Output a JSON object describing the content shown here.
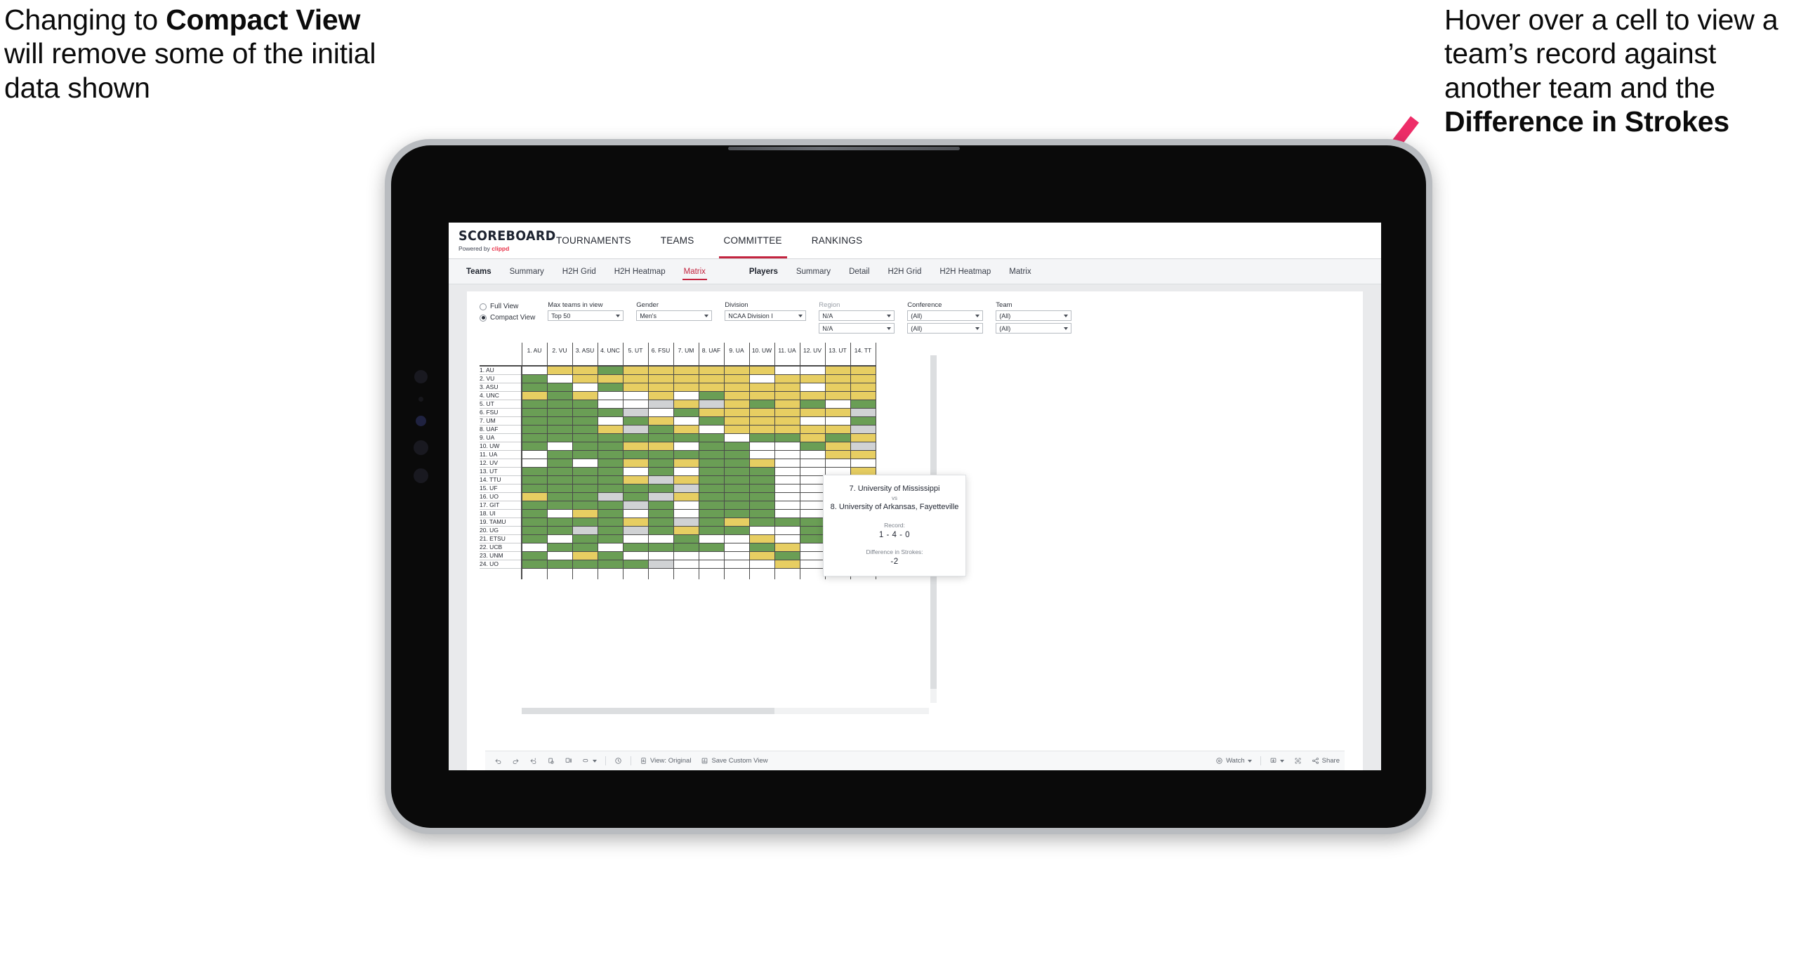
{
  "annotations": {
    "left": {
      "parts": [
        {
          "t": "Changing to ",
          "b": false
        },
        {
          "t": "Compact View",
          "b": true
        },
        {
          "t": " will remove some of the initial data shown",
          "b": false
        }
      ]
    },
    "right": {
      "parts": [
        {
          "t": "Hover over a cell to view a team’s record against another team and the ",
          "b": false
        },
        {
          "t": "Difference in Strokes",
          "b": true
        }
      ]
    },
    "arrow_color": "#ee2d68"
  },
  "app": {
    "brand": {
      "name": "SCOREBOARD",
      "powered_prefix": "Powered by ",
      "powered_brand": "clippd"
    },
    "top_nav": [
      {
        "label": "TOURNAMENTS",
        "active": false
      },
      {
        "label": "TEAMS",
        "active": false
      },
      {
        "label": "COMMITTEE",
        "active": true
      },
      {
        "label": "RANKINGS",
        "active": false
      }
    ],
    "sub_nav": {
      "teams_group": [
        {
          "label": "Teams",
          "head": true,
          "active": false
        },
        {
          "label": "Summary",
          "head": false,
          "active": false
        },
        {
          "label": "H2H Grid",
          "head": false,
          "active": false
        },
        {
          "label": "H2H Heatmap",
          "head": false,
          "active": false
        },
        {
          "label": "Matrix",
          "head": false,
          "active": true
        }
      ],
      "players_group": [
        {
          "label": "Players",
          "head": true,
          "active": false
        },
        {
          "label": "Summary",
          "head": false,
          "active": false
        },
        {
          "label": "Detail",
          "head": false,
          "active": false
        },
        {
          "label": "H2H Grid",
          "head": false,
          "active": false
        },
        {
          "label": "H2H Heatmap",
          "head": false,
          "active": false
        },
        {
          "label": "Matrix",
          "head": false,
          "active": false
        }
      ]
    },
    "filters": {
      "view_modes": [
        {
          "label": "Full View",
          "selected": false
        },
        {
          "label": "Compact View",
          "selected": true
        }
      ],
      "max_teams": {
        "label": "Max teams in view",
        "value": "Top 50"
      },
      "gender": {
        "label": "Gender",
        "value": "Men's"
      },
      "division": {
        "label": "Division",
        "value": "NCAA Division I"
      },
      "region": {
        "label": "Region",
        "value1": "N/A",
        "value2": "N/A"
      },
      "conference": {
        "label": "Conference",
        "value1": "(All)",
        "value2": "(All)"
      },
      "team": {
        "label": "Team",
        "value1": "(All)",
        "value2": "(All)"
      }
    },
    "tooltip": {
      "team_a": "7. University of Mississippi",
      "vs": "vs",
      "team_b": "8. University of Arkansas, Fayetteville",
      "record_label": "Record:",
      "record_value": "1 - 4 - 0",
      "diff_label": "Difference in Strokes:",
      "diff_value": "-2"
    },
    "toolbar": {
      "items": [
        {
          "name": "undo-icon",
          "label": "",
          "icon": "undo",
          "caret": false
        },
        {
          "name": "redo-icon",
          "label": "",
          "icon": "redo",
          "caret": false
        },
        {
          "name": "revert-icon",
          "label": "",
          "icon": "revert",
          "caret": false
        },
        {
          "name": "refresh-data-icon",
          "label": "",
          "icon": "refresh",
          "caret": false
        },
        {
          "name": "pause-auto-update-icon",
          "label": "",
          "icon": "pause",
          "caret": false
        },
        {
          "name": "highlight-icon",
          "label": "",
          "icon": "pill",
          "caret": true
        },
        {
          "name": "sep",
          "label": "",
          "icon": "sep",
          "caret": false
        },
        {
          "name": "history-icon",
          "label": "",
          "icon": "clock",
          "caret": false
        },
        {
          "name": "sep",
          "label": "",
          "icon": "sep",
          "caret": false
        },
        {
          "name": "view-original-button",
          "label": "View: Original",
          "icon": "device",
          "caret": false
        },
        {
          "name": "save-custom-view-button",
          "label": "Save Custom View",
          "icon": "save",
          "caret": false
        },
        {
          "name": "spacer",
          "label": "",
          "icon": "spacer",
          "caret": false
        },
        {
          "name": "watch-button",
          "label": "Watch",
          "icon": "eye",
          "caret": true
        },
        {
          "name": "sep",
          "label": "",
          "icon": "sep",
          "caret": false
        },
        {
          "name": "download-button",
          "label": "",
          "icon": "download",
          "caret": true
        },
        {
          "name": "fullscreen-button",
          "label": "",
          "icon": "fullscreen",
          "caret": false
        },
        {
          "name": "share-button",
          "label": "Share",
          "icon": "share",
          "caret": false
        }
      ]
    }
  },
  "chart_data": {
    "type": "heatmap",
    "title": "Team Head-to-Head Matrix",
    "xlabel": "",
    "ylabel": "",
    "legend_position": "none",
    "grid": true,
    "color_map": {
      "green": "#6a9e55",
      "yellow": "#e7ce62",
      "white": "#ffffff",
      "grey": "#d0d2d4"
    },
    "color_meaning": {
      "green": "winning record",
      "yellow": "losing record",
      "white": "no matchups",
      "grey": "even record"
    },
    "columns": [
      "1. AU",
      "2. VU",
      "3. ASU",
      "4. UNC",
      "5. UT",
      "6. FSU",
      "7. UM",
      "8. UAF",
      "9. UA",
      "10. UW",
      "11. UA",
      "12. UV",
      "13. UT",
      "14. TT"
    ],
    "rows": [
      "1. AU",
      "2. VU",
      "3. ASU",
      "4. UNC",
      "5. UT",
      "6. FSU",
      "7. UM",
      "8. UAF",
      "9. UA",
      "10. UW",
      "11. UA",
      "12. UV",
      "13. UT",
      "14. TTU",
      "15. UF",
      "16. UO",
      "17. GIT",
      "18. UI",
      "19. TAMU",
      "20. UG",
      "21. ETSU",
      "22. UCB",
      "23. UNM",
      "24. UO"
    ],
    "cells": [
      [
        "w",
        "y",
        "y",
        "g",
        "y",
        "y",
        "y",
        "y",
        "y",
        "y",
        "w",
        "w",
        "y",
        "y"
      ],
      [
        "g",
        "w",
        "y",
        "y",
        "y",
        "y",
        "y",
        "y",
        "y",
        "w",
        "y",
        "y",
        "y",
        "y"
      ],
      [
        "g",
        "g",
        "w",
        "g",
        "y",
        "y",
        "y",
        "y",
        "y",
        "y",
        "y",
        "w",
        "y",
        "y"
      ],
      [
        "y",
        "g",
        "y",
        "w",
        "w",
        "y",
        "w",
        "g",
        "y",
        "y",
        "y",
        "y",
        "y",
        "y"
      ],
      [
        "g",
        "g",
        "g",
        "w",
        "w",
        "s",
        "y",
        "s",
        "y",
        "g",
        "y",
        "g",
        "w",
        "g"
      ],
      [
        "g",
        "g",
        "g",
        "g",
        "s",
        "w",
        "g",
        "y",
        "y",
        "y",
        "y",
        "y",
        "y",
        "s"
      ],
      [
        "g",
        "g",
        "g",
        "w",
        "g",
        "y",
        "w",
        "g",
        "y",
        "y",
        "y",
        "w",
        "w",
        "g"
      ],
      [
        "g",
        "g",
        "g",
        "y",
        "s",
        "g",
        "y",
        "w",
        "y",
        "y",
        "y",
        "y",
        "y",
        "s"
      ],
      [
        "g",
        "g",
        "g",
        "g",
        "g",
        "g",
        "g",
        "g",
        "w",
        "g",
        "g",
        "y",
        "g",
        "y"
      ],
      [
        "g",
        "w",
        "g",
        "g",
        "y",
        "y",
        "w",
        "g",
        "g",
        "w",
        "w",
        "g",
        "y",
        "s"
      ],
      [
        "w",
        "g",
        "g",
        "g",
        "g",
        "g",
        "g",
        "g",
        "g",
        "w",
        "w",
        "w",
        "y",
        "y"
      ],
      [
        "w",
        "g",
        "w",
        "g",
        "y",
        "g",
        "y",
        "g",
        "g",
        "y",
        "w",
        "w",
        "w",
        "w"
      ],
      [
        "g",
        "g",
        "g",
        "g",
        "w",
        "g",
        "w",
        "g",
        "g",
        "g",
        "w",
        "w",
        "w",
        "y"
      ],
      [
        "g",
        "g",
        "g",
        "g",
        "y",
        "s",
        "y",
        "g",
        "g",
        "g",
        "w",
        "w",
        "g",
        "w"
      ],
      [
        "g",
        "g",
        "g",
        "g",
        "g",
        "g",
        "s",
        "g",
        "g",
        "g",
        "w",
        "w",
        "g",
        "w"
      ],
      [
        "y",
        "g",
        "g",
        "s",
        "g",
        "s",
        "y",
        "g",
        "g",
        "g",
        "w",
        "w",
        "y",
        "y"
      ],
      [
        "g",
        "g",
        "g",
        "g",
        "s",
        "g",
        "w",
        "g",
        "g",
        "g",
        "w",
        "w",
        "s",
        "y"
      ],
      [
        "g",
        "w",
        "y",
        "g",
        "w",
        "g",
        "w",
        "g",
        "g",
        "g",
        "w",
        "w",
        "g",
        "y"
      ],
      [
        "g",
        "g",
        "g",
        "g",
        "y",
        "g",
        "s",
        "g",
        "y",
        "g",
        "g",
        "g",
        "s",
        "y"
      ],
      [
        "g",
        "g",
        "s",
        "g",
        "s",
        "g",
        "y",
        "g",
        "g",
        "w",
        "w",
        "g",
        "s",
        "y"
      ],
      [
        "g",
        "w",
        "g",
        "g",
        "w",
        "w",
        "g",
        "w",
        "w",
        "y",
        "w",
        "g",
        "g",
        "w"
      ],
      [
        "w",
        "g",
        "g",
        "w",
        "g",
        "g",
        "g",
        "g",
        "w",
        "g",
        "y",
        "w",
        "y",
        "g"
      ],
      [
        "g",
        "w",
        "y",
        "g",
        "w",
        "w",
        "w",
        "w",
        "w",
        "y",
        "g",
        "w",
        "g",
        "y"
      ],
      [
        "g",
        "g",
        "g",
        "g",
        "g",
        "s",
        "w",
        "w",
        "w",
        "w",
        "y",
        "w",
        "y",
        "g"
      ]
    ]
  }
}
